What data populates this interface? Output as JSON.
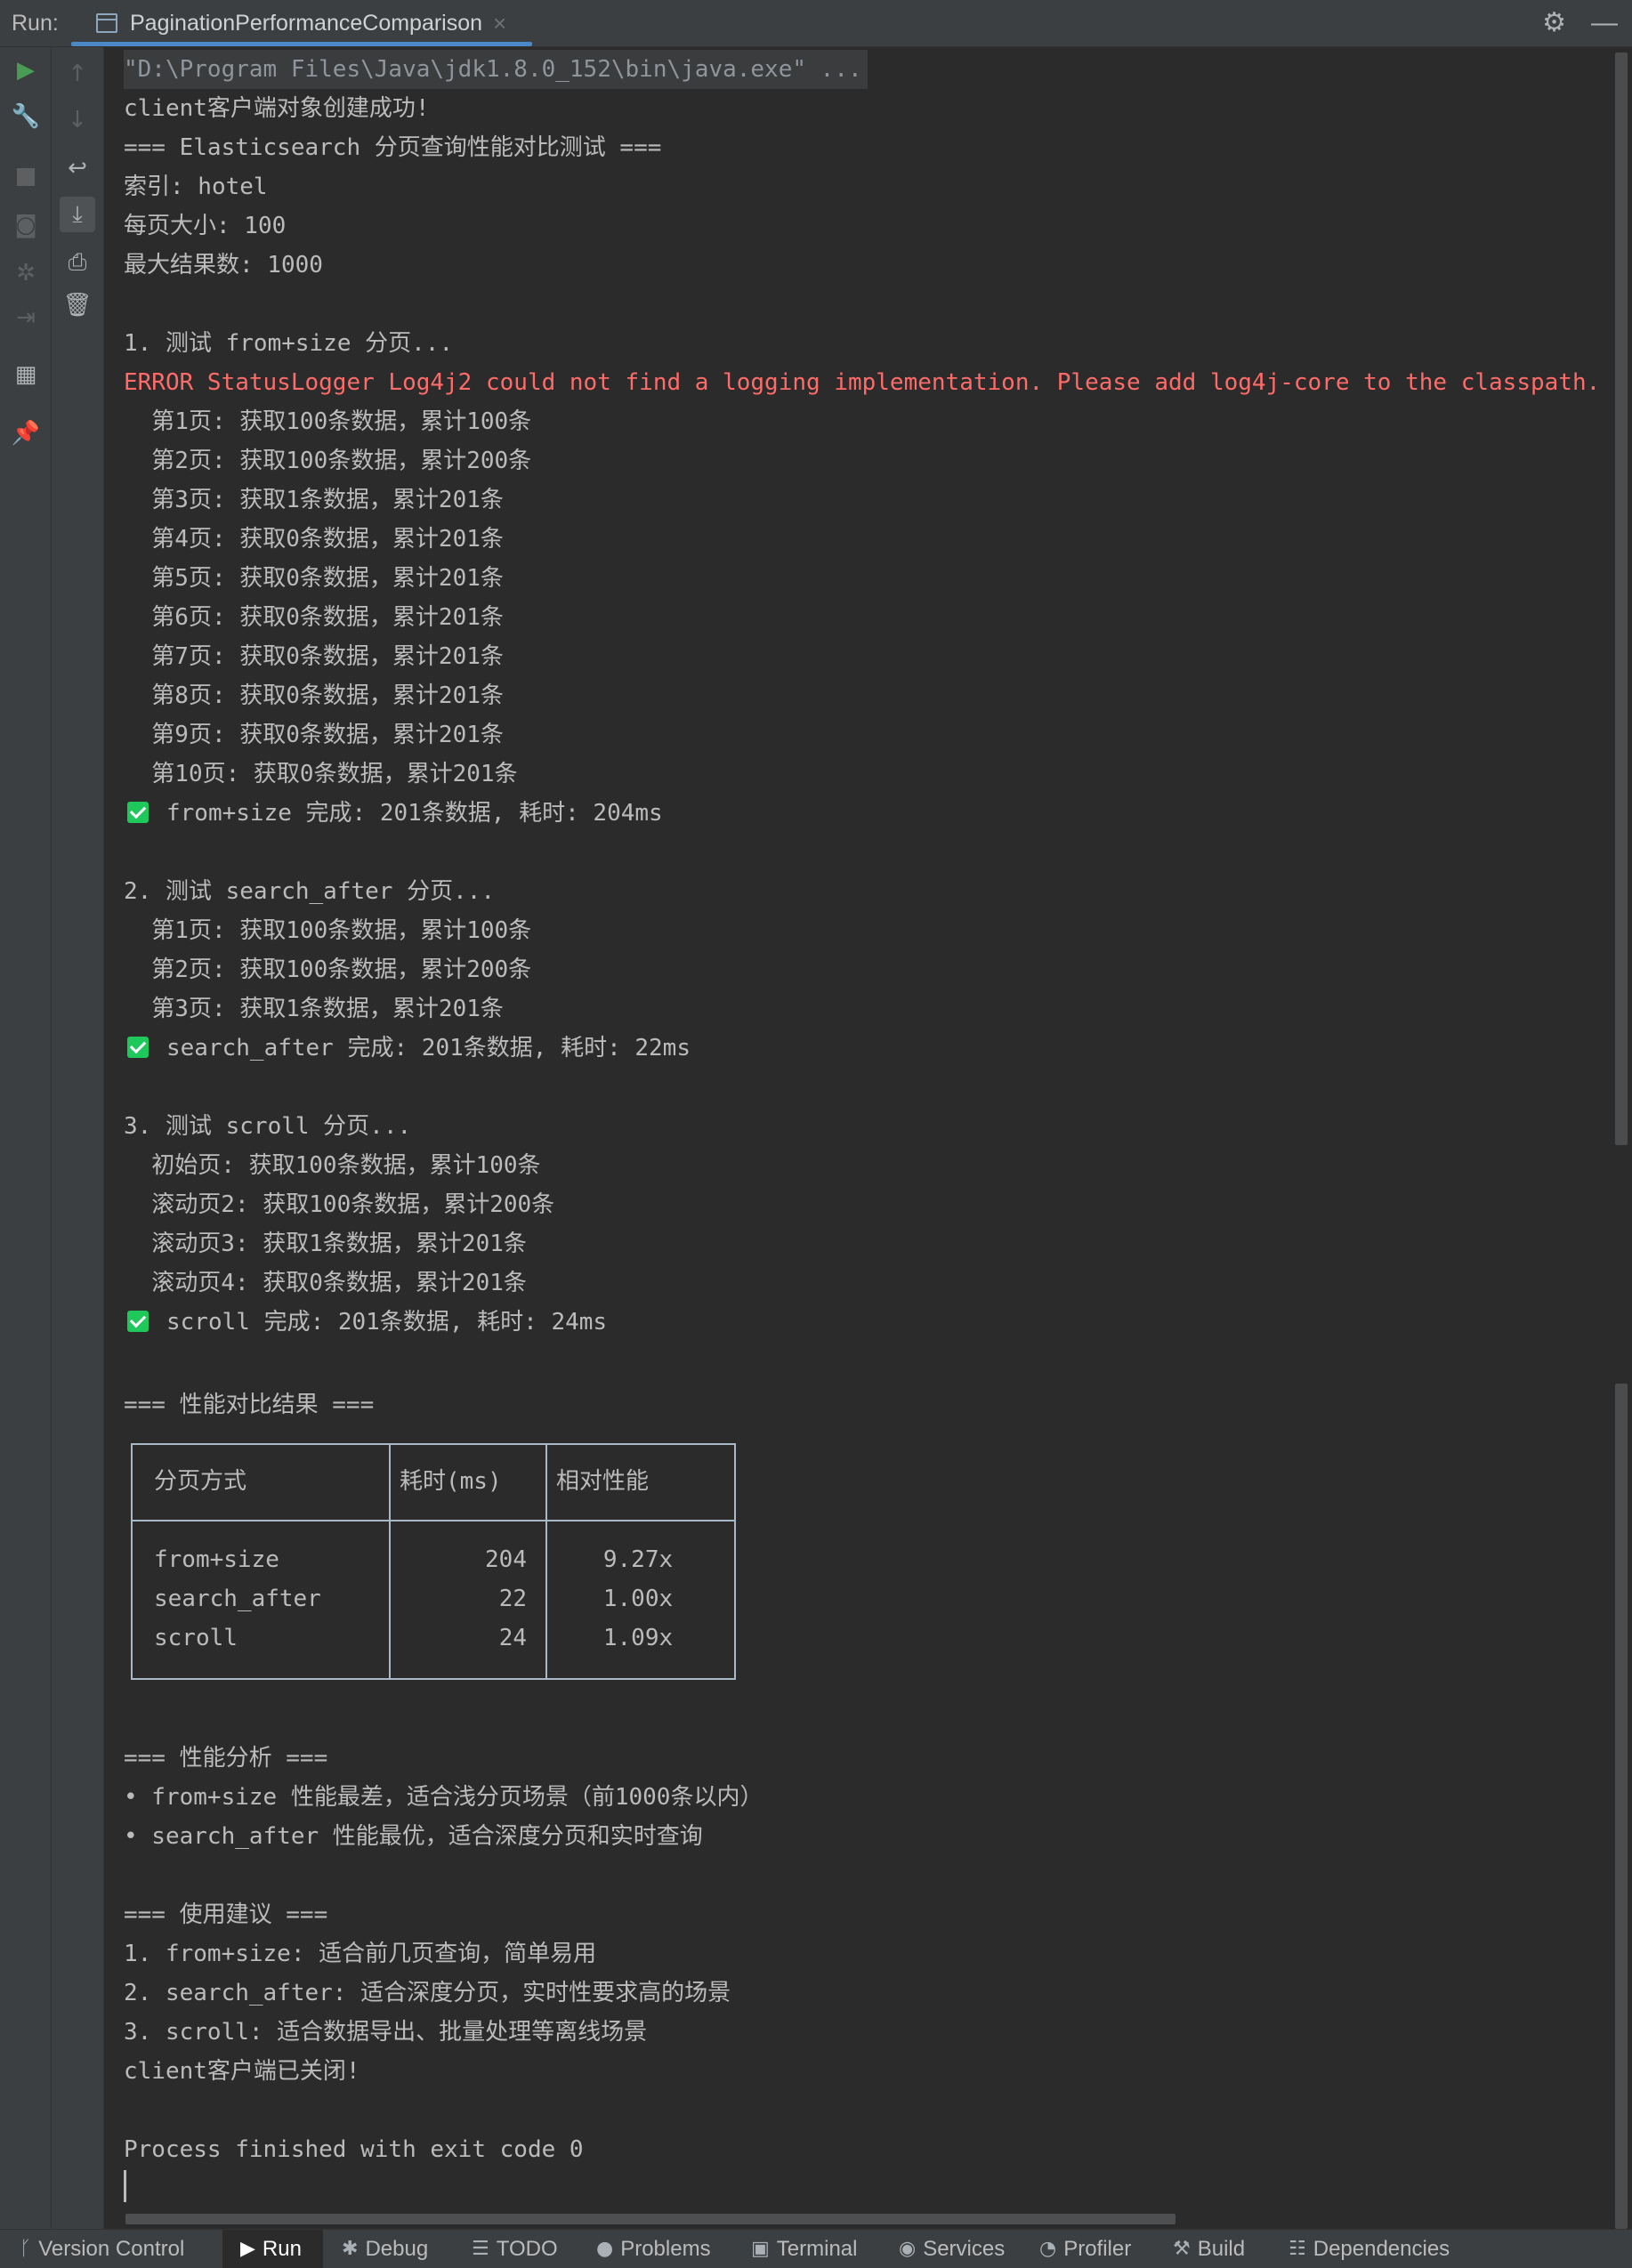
{
  "topbar": {
    "run_label": "Run:",
    "tab_title": "PaginationPerformanceComparison",
    "close_glyph": "×",
    "settings_icon": "⚙",
    "minimize_icon": "—"
  },
  "console": {
    "lines": [
      "\"D:\\Program Files\\Java\\jdk1.8.0_152\\bin\\java.exe\" ...",
      "client客户端对象创建成功!",
      "=== Elasticsearch 分页查询性能对比测试 ===",
      "索引: hotel",
      "每页大小: 100",
      "最大结果数: 1000",
      "1. 测试 from+size 分页...",
      "ERROR StatusLogger Log4j2 could not find a logging implementation. Please add log4j-core to the classpath. Using SimpleLog",
      "  第1页: 获取100条数据，累计100条",
      "  第2页: 获取100条数据，累计200条",
      "  第3页: 获取1条数据，累计201条",
      "  第4页: 获取0条数据，累计201条",
      "  第5页: 获取0条数据，累计201条",
      "  第6页: 获取0条数据，累计201条",
      "  第7页: 获取0条数据，累计201条",
      "  第8页: 获取0条数据，累计201条",
      "  第9页: 获取0条数据，累计201条",
      "  第10页: 获取0条数据，累计201条",
      "from+size 完成: 201条数据, 耗时: 204ms",
      "2. 测试 search_after 分页...",
      "  第1页: 获取100条数据，累计100条",
      "  第2页: 获取100条数据，累计200条",
      "  第3页: 获取1条数据，累计201条",
      "search_after 完成: 201条数据, 耗时: 22ms",
      "3. 测试 scroll 分页...",
      "  初始页: 获取100条数据，累计100条",
      "  滚动页2: 获取100条数据，累计200条",
      "  滚动页3: 获取1条数据，累计201条",
      "  滚动页4: 获取0条数据，累计201条",
      "scroll 完成: 201条数据, 耗时: 24ms",
      "=== 性能对比结果 ===",
      "=== 性能分析 ===",
      "• from+size 性能最差，适合浅分页场景（前1000条以内）",
      "• search_after 性能最优，适合深度分页和实时查询",
      "=== 使用建议 ===",
      "1. from+size: 适合前几页查询，简单易用",
      "2. search_after: 适合深度分页，实时性要求高的场景",
      "3. scroll: 适合数据导出、批量处理等离线场景",
      "client客户端已关闭!",
      "Process finished with exit code 0"
    ],
    "table": {
      "headers": [
        "分页方式",
        "耗时(ms)",
        "相对性能"
      ],
      "rows": [
        [
          "from+size",
          "204",
          "9.27x"
        ],
        [
          "search_after",
          "22",
          "1.00x"
        ],
        [
          "scroll",
          "24",
          "1.09x"
        ]
      ]
    }
  },
  "statusbar": {
    "items": [
      {
        "label": "Version Control",
        "icon": "version-control-icon"
      },
      {
        "label": "Run",
        "icon": "run-icon"
      },
      {
        "label": "Debug",
        "icon": "debug-icon"
      },
      {
        "label": "TODO",
        "icon": "todo-icon"
      },
      {
        "label": "Problems",
        "icon": "problems-icon"
      },
      {
        "label": "Terminal",
        "icon": "terminal-icon"
      },
      {
        "label": "Services",
        "icon": "services-icon"
      },
      {
        "label": "Profiler",
        "icon": "profiler-icon"
      },
      {
        "label": "Build",
        "icon": "build-icon"
      },
      {
        "label": "Dependencies",
        "icon": "dependencies-icon"
      }
    ]
  },
  "colors": {
    "background": "#2b2b2b",
    "panel": "#3c3f41",
    "text": "#bbbbbb",
    "error": "#ff6b68",
    "success": "#1ec85a",
    "accent": "#4a88c7",
    "run_green": "#499c54"
  }
}
